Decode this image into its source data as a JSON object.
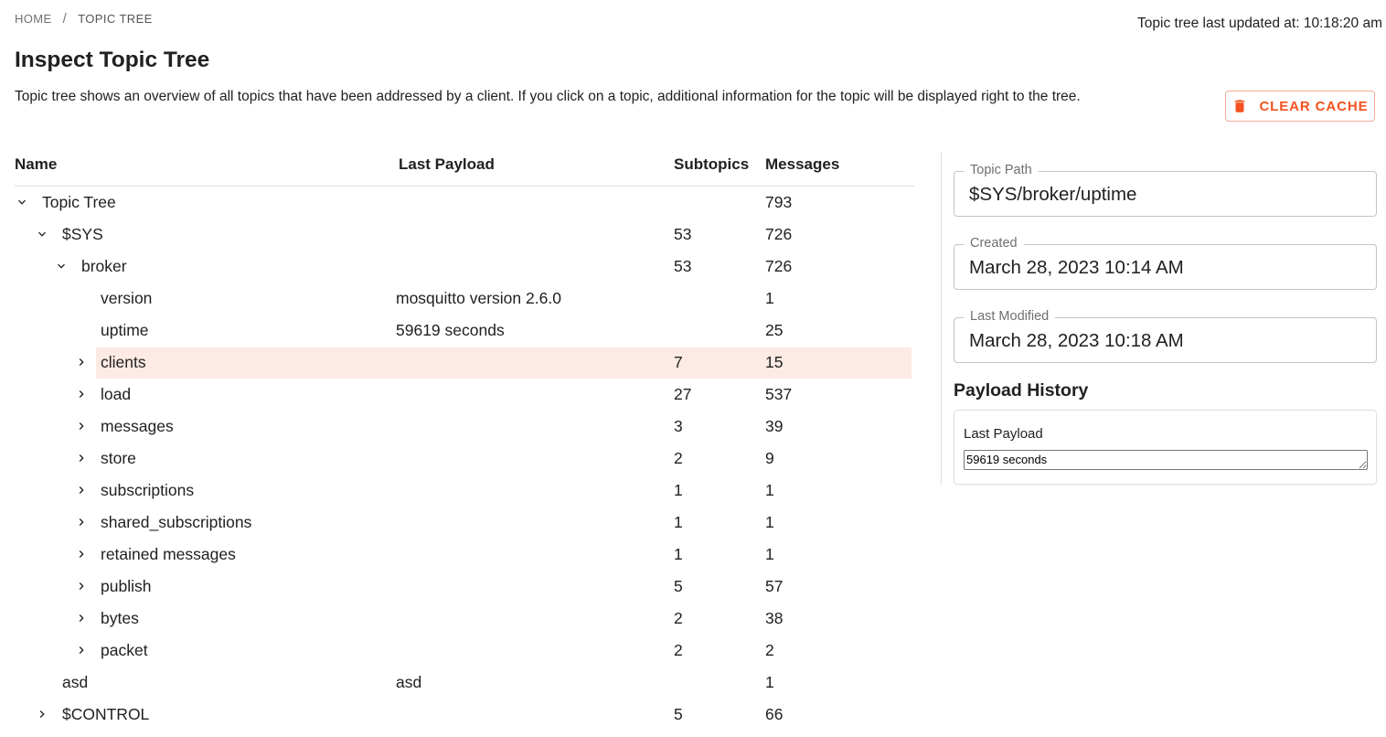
{
  "breadcrumb": {
    "home": "HOME",
    "separator": "/",
    "current": "TOPIC TREE"
  },
  "last_updated": "Topic tree last updated at: 10:18:20 am",
  "title": "Inspect Topic Tree",
  "description": "Topic tree shows an overview of all topics that have been addressed by a client. If you click on a topic, additional information for the topic will be displayed right to the tree.",
  "clear_cache": {
    "label": "CLEAR CACHE",
    "icon": "trash-icon",
    "color": "#f4511e"
  },
  "table": {
    "headers": {
      "name": "Name",
      "payload": "Last Payload",
      "subtopics": "Subtopics",
      "messages": "Messages"
    },
    "rows": [
      {
        "level": 0,
        "toggle": "expanded",
        "name": "Topic Tree",
        "payload": "",
        "subtopics": "",
        "messages": "793",
        "selected": false
      },
      {
        "level": 1,
        "toggle": "expanded",
        "name": "$SYS",
        "payload": "",
        "subtopics": "53",
        "messages": "726",
        "selected": false
      },
      {
        "level": 2,
        "toggle": "expanded",
        "name": "broker",
        "payload": "",
        "subtopics": "53",
        "messages": "726",
        "selected": false
      },
      {
        "level": 3,
        "toggle": "none",
        "name": "version",
        "payload": "mosquitto version 2.6.0",
        "subtopics": "",
        "messages": "1",
        "selected": false
      },
      {
        "level": 3,
        "toggle": "none",
        "name": "uptime",
        "payload": "59619 seconds",
        "subtopics": "",
        "messages": "25",
        "selected": false
      },
      {
        "level": 3,
        "toggle": "collapsed",
        "name": "clients",
        "payload": "",
        "subtopics": "7",
        "messages": "15",
        "selected": true
      },
      {
        "level": 3,
        "toggle": "collapsed",
        "name": "load",
        "payload": "",
        "subtopics": "27",
        "messages": "537",
        "selected": false
      },
      {
        "level": 3,
        "toggle": "collapsed",
        "name": "messages",
        "payload": "",
        "subtopics": "3",
        "messages": "39",
        "selected": false
      },
      {
        "level": 3,
        "toggle": "collapsed",
        "name": "store",
        "payload": "",
        "subtopics": "2",
        "messages": "9",
        "selected": false
      },
      {
        "level": 3,
        "toggle": "collapsed",
        "name": "subscriptions",
        "payload": "",
        "subtopics": "1",
        "messages": "1",
        "selected": false
      },
      {
        "level": 3,
        "toggle": "collapsed",
        "name": "shared_subscriptions",
        "payload": "",
        "subtopics": "1",
        "messages": "1",
        "selected": false
      },
      {
        "level": 3,
        "toggle": "collapsed",
        "name": "retained messages",
        "payload": "",
        "subtopics": "1",
        "messages": "1",
        "selected": false
      },
      {
        "level": 3,
        "toggle": "collapsed",
        "name": "publish",
        "payload": "",
        "subtopics": "5",
        "messages": "57",
        "selected": false
      },
      {
        "level": 3,
        "toggle": "collapsed",
        "name": "bytes",
        "payload": "",
        "subtopics": "2",
        "messages": "38",
        "selected": false
      },
      {
        "level": 3,
        "toggle": "collapsed",
        "name": "packet",
        "payload": "",
        "subtopics": "2",
        "messages": "2",
        "selected": false
      },
      {
        "level": 1,
        "toggle": "none",
        "name": "asd",
        "payload": "asd",
        "subtopics": "",
        "messages": "1",
        "selected": false
      },
      {
        "level": 1,
        "toggle": "collapsed",
        "name": "$CONTROL",
        "payload": "",
        "subtopics": "5",
        "messages": "66",
        "selected": false
      }
    ]
  },
  "details": {
    "topic_path": {
      "label": "Topic Path",
      "value": "$SYS/broker/uptime"
    },
    "created": {
      "label": "Created",
      "value": "March 28, 2023 10:14 AM"
    },
    "last_modified": {
      "label": "Last Modified",
      "value": "March 28, 2023 10:18 AM"
    },
    "payload_history": {
      "title": "Payload History",
      "label": "Last Payload",
      "value": "59619 seconds"
    }
  },
  "colors": {
    "selected_row": "#fdeae4",
    "accent": "#f4511e"
  }
}
